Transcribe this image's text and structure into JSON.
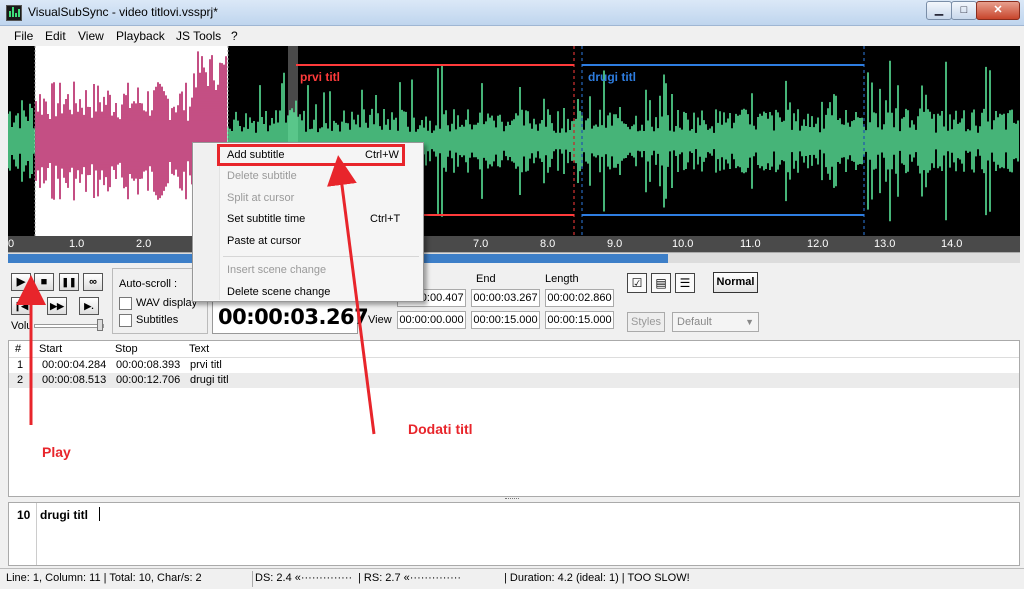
{
  "window": {
    "title": "VisualSubSync - video titlovi.vssprj*",
    "min": "▁",
    "max": "□",
    "close": "✕"
  },
  "menu": [
    "File",
    "Edit",
    "View",
    "Playback",
    "JS Tools",
    "?"
  ],
  "waveform": {
    "subtitle_1": "prvi titl",
    "subtitle_2": "drugi titl",
    "subtitle_1_color": "#ff3b3b",
    "subtitle_2_color": "#2e7de0",
    "wave_color": "#5ef0a0",
    "selection_color": "#b0145a",
    "ruler_ticks": [
      "0",
      "1.0",
      "2.0",
      "7.0",
      "8.0",
      "9.0",
      "10.0",
      "11.0",
      "12.0",
      "13.0",
      "14.0"
    ]
  },
  "context_menu": {
    "items": [
      {
        "label": "Add subtitle",
        "shortcut": "Ctrl+W",
        "enabled": true
      },
      {
        "label": "Delete subtitle",
        "shortcut": "",
        "enabled": false
      },
      {
        "label": "Split at cursor",
        "shortcut": "",
        "enabled": false
      },
      {
        "label": "Set subtitle time",
        "shortcut": "Ctrl+T",
        "enabled": true
      },
      {
        "label": "Paste at cursor",
        "shortcut": "",
        "enabled": true
      },
      {
        "label": "Insert scene change",
        "shortcut": "",
        "enabled": false
      },
      {
        "label": "Delete scene change",
        "shortcut": "",
        "enabled": true
      }
    ]
  },
  "playback": {
    "play": "▶",
    "stop": "■",
    "pause": "❚❚",
    "loop": "∞",
    "prev": "❙◀",
    "next": "▶▶",
    "step": "▶.",
    "volume_label": "Volu"
  },
  "autoscroll": {
    "label": "Auto-scroll :",
    "wav_display": "WAV display",
    "subtitles": "Subtitles"
  },
  "time": {
    "current": "00:00:03.267",
    "start_header": "",
    "end_header": "End",
    "length_header": "Length",
    "sel_start": "00:00:00.407",
    "sel_end": "00:00:03.267",
    "sel_length": "00:00:02.860",
    "view_label": "View",
    "view_start": "00:00:00.000",
    "view_end": "00:00:15.000",
    "view_length": "00:00:15.000"
  },
  "right_panel": {
    "normal": "Normal",
    "styles": "Styles",
    "style_default": "Default"
  },
  "list": {
    "headers": [
      "#",
      "Start",
      "Stop",
      "Text"
    ],
    "rows": [
      {
        "n": "1",
        "start": "00:00:04.284",
        "stop": "00:00:08.393",
        "text": "prvi titl"
      },
      {
        "n": "2",
        "start": "00:00:08.513",
        "stop": "00:00:12.706",
        "text": "drugi titl"
      }
    ]
  },
  "editor": {
    "line_number": "10",
    "text": "drugi titl"
  },
  "status": {
    "position": "Line: 1, Column: 11 | Total: 10, Char/s: 2",
    "ds": "DS: 2.4 «··············",
    "rs": "| RS: 2.7 «··············",
    "duration": "| Duration: 4.2 (ideal: 1) | TOO SLOW!"
  },
  "annotations": {
    "play": "Play",
    "add": "Dodati titl",
    "color": "#e8252b"
  }
}
